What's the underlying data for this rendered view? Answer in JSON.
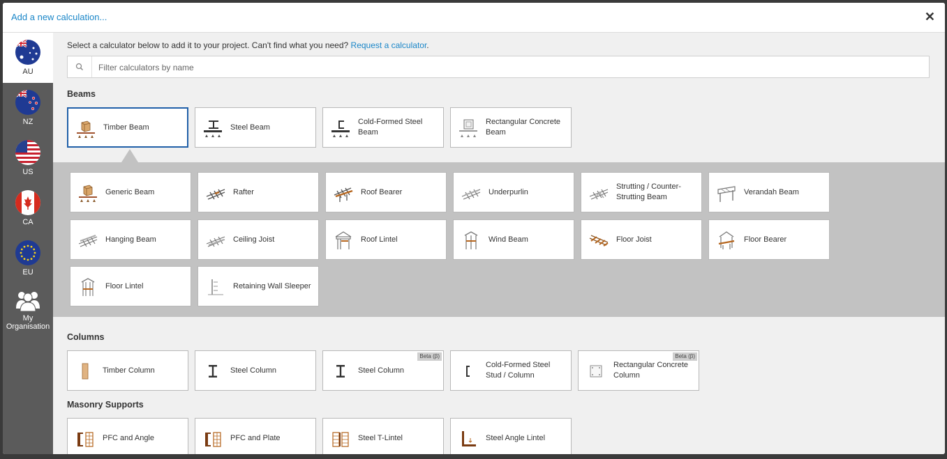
{
  "header": {
    "title": "Add a new calculation...",
    "close_icon": "close-icon"
  },
  "sidebar": {
    "regions": [
      {
        "code": "AU",
        "icon": "flag-au-icon"
      },
      {
        "code": "NZ",
        "icon": "flag-nz-icon"
      },
      {
        "code": "US",
        "icon": "flag-us-icon"
      },
      {
        "code": "CA",
        "icon": "flag-ca-icon"
      },
      {
        "code": "EU",
        "icon": "flag-eu-icon"
      }
    ],
    "org_line1": "My",
    "org_line2": "Organisation"
  },
  "intro": {
    "text": "Select a calculator below to add it to your project. Can't find what you need?",
    "link": "Request a calculator",
    "suffix": "."
  },
  "search": {
    "placeholder": "Filter calculators by name"
  },
  "sections": {
    "beams": "Beams",
    "columns": "Columns",
    "masonry": "Masonry Supports"
  },
  "beams": [
    "Timber Beam",
    "Steel Beam",
    "Cold-Formed Steel Beam",
    "Rectangular Concrete Beam"
  ],
  "timber_beams": [
    "Generic Beam",
    "Rafter",
    "Roof Bearer",
    "Underpurlin",
    "Strutting / Counter-Strutting Beam",
    "Verandah Beam",
    "Hanging Beam",
    "Ceiling Joist",
    "Roof Lintel",
    "Wind Beam",
    "Floor Joist",
    "Floor Bearer",
    "Floor Lintel",
    "Retaining Wall Sleeper"
  ],
  "columns": [
    "Timber Column",
    "Steel Column",
    "Steel Column",
    "Cold-Formed Steel Stud / Column",
    "Rectangular Concrete Column"
  ],
  "beta_label": "Beta (β)",
  "masonry": [
    "PFC and Angle",
    "PFC and Plate",
    "Steel T-Lintel",
    "Steel Angle Lintel"
  ],
  "colors": {
    "accent": "#1a86c8",
    "selected_border": "#1f5fa8",
    "sidebar": "#5b5b5b",
    "subpanel": "#c2c2c2"
  }
}
